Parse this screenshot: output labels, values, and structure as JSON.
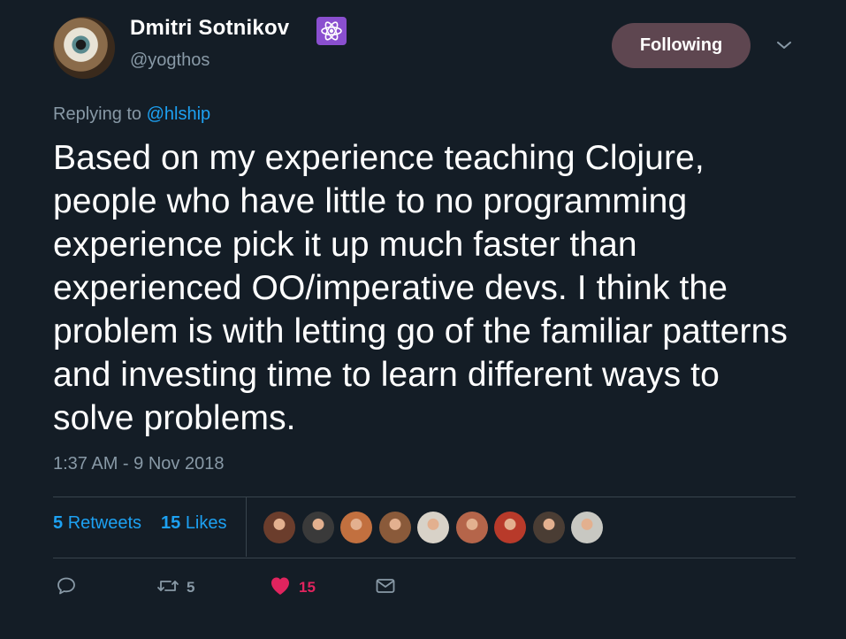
{
  "author": {
    "name": "Dmitri Sotnikov",
    "handle": "@yogthos",
    "emoji_icon": "atom-icon"
  },
  "follow_button": {
    "label": "Following"
  },
  "reply": {
    "prefix": "Replying to ",
    "handle": "@hlship"
  },
  "tweet": {
    "text": "Based on my experience teaching Clojure, people who have little to no programming experience pick it up much faster than experienced OO/imperative devs. I think the problem is with letting go of the familiar patterns and investing time to learn different ways to solve problems.",
    "timestamp": "1:37 AM - 9 Nov 2018"
  },
  "stats": {
    "retweets_count": "5",
    "retweets_label": "Retweets",
    "likes_count": "15",
    "likes_label": "Likes"
  },
  "likers": [
    {
      "name": "liker-1",
      "color": "#6b3d2c"
    },
    {
      "name": "liker-2",
      "color": "#3a3a3a"
    },
    {
      "name": "liker-3",
      "color": "#c2703f"
    },
    {
      "name": "liker-4",
      "color": "#8a5a3a"
    },
    {
      "name": "liker-5",
      "color": "#d8d2c8"
    },
    {
      "name": "liker-6",
      "color": "#b5654a"
    },
    {
      "name": "liker-7",
      "color": "#b83a2a"
    },
    {
      "name": "liker-8",
      "color": "#4a3d34"
    },
    {
      "name": "liker-9",
      "color": "#c8c8c2"
    }
  ],
  "actions": {
    "reply_icon": "reply-icon",
    "retweet_icon": "retweet-icon",
    "retweet_count": "5",
    "like_icon": "heart-icon",
    "like_count": "15",
    "message_icon": "envelope-icon"
  },
  "colors": {
    "background": "#141d26",
    "link": "#1da1f2",
    "muted": "#8899a6",
    "like": "#e0245e",
    "follow_button": "#5e4650",
    "emoji_bg": "#8a4fcf"
  }
}
